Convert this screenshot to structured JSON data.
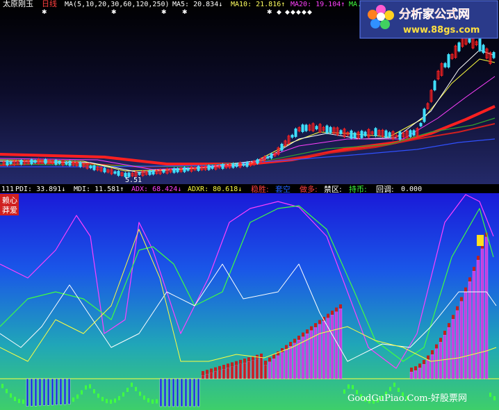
{
  "main_header": {
    "title": "太原刚玉",
    "period": "日线",
    "ma_params": "MA(5,10,20,30,60,120,250)",
    "ma5": "MA5: 20.834↓",
    "ma10": "MA10: 21.816↑",
    "ma20": "MA20: 19.104↑",
    "ma_extra": "MA...",
    "low_marker": "5.51"
  },
  "indicator_header": {
    "id": "111",
    "pdi": "PDI: 33.891↓",
    "mdi": "MDI: 11.581↑",
    "adx": "ADX: 68.424↓",
    "adxr": "ADXR: 80.618↓",
    "labels": [
      "稳胜:",
      "套空",
      "做多:",
      "禁区:",
      "持币:",
      "回调:"
    ],
    "value": "0.000"
  },
  "side_labels": [
    "赖心",
    "莽爱"
  ],
  "logo": {
    "title": "分析家公式网",
    "url": "www.88gs.com"
  },
  "watermark": "GoodGuPiao.Com-好股票网",
  "colors": {
    "red": "#ff2020",
    "cyan": "#40e0ff",
    "magenta": "#ff40ff",
    "yellow": "#ffff40",
    "green": "#40ff40",
    "white": "#ffffff"
  }
}
